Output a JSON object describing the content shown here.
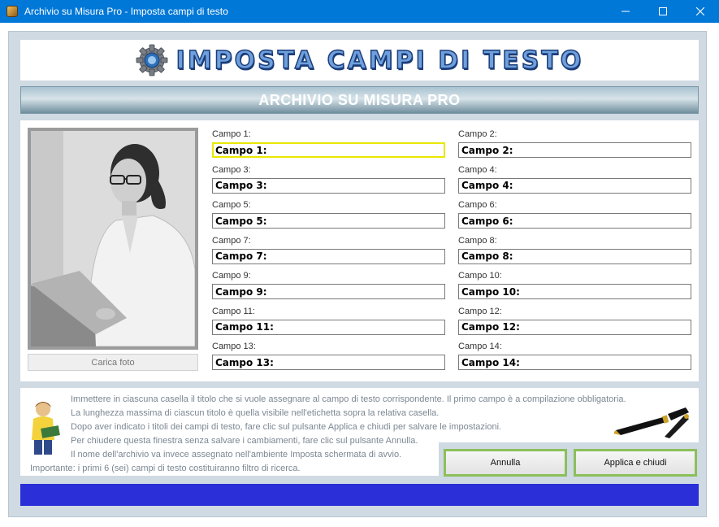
{
  "window": {
    "title": "Archivio su Misura Pro - Imposta campi di testo",
    "minimize_icon": "minimize-icon",
    "maximize_icon": "maximize-icon",
    "close_icon": "close-icon"
  },
  "header": {
    "title": "IMPOSTA CAMPI DI TESTO",
    "subtitle": "ARCHIVIO SU MISURA PRO",
    "logo_icon": "gear-icon"
  },
  "photo": {
    "button_label": "Carica foto"
  },
  "fields": [
    {
      "label": "Campo 1:",
      "value": "Campo 1:"
    },
    {
      "label": "Campo 2:",
      "value": "Campo 2:"
    },
    {
      "label": "Campo 3:",
      "value": "Campo 3:"
    },
    {
      "label": "Campo 4:",
      "value": "Campo 4:"
    },
    {
      "label": "Campo 5:",
      "value": "Campo 5:"
    },
    {
      "label": "Campo 6:",
      "value": "Campo 6:"
    },
    {
      "label": "Campo 7:",
      "value": "Campo 7:"
    },
    {
      "label": "Campo 8:",
      "value": "Campo 8:"
    },
    {
      "label": "Campo 9:",
      "value": "Campo 9:"
    },
    {
      "label": "Campo 10:",
      "value": "Campo 10:"
    },
    {
      "label": "Campo 11:",
      "value": "Campo 11:"
    },
    {
      "label": "Campo 12:",
      "value": "Campo 12:"
    },
    {
      "label": "Campo 13:",
      "value": "Campo 13:"
    },
    {
      "label": "Campo 14:",
      "value": "Campo 14:"
    }
  ],
  "info": [
    "Immettere in ciascuna casella il titolo che si vuole assegnare al campo di testo corrispondente. Il primo campo è a compilazione obbligatoria.",
    "La lunghezza massima di ciascun titolo è quella visibile nell'etichetta sopra la relativa casella.",
    "Dopo aver indicato i titoli dei campi di testo, fare clic sul pulsante Applica e chiudi per salvare le impostazioni.",
    "Per chiudere questa finestra senza salvare i cambiamenti, fare clic sul pulsante Annulla.",
    "Il nome dell'archivio va invece assegnato nell'ambiente Imposta schermata di avvio.",
    "Importante: i primi 6 (sei) campi di testo costituiranno filtro di ricerca."
  ],
  "buttons": {
    "cancel": "Annulla",
    "apply": "Applica e chiudi"
  },
  "colors": {
    "titlebar": "#0078d7",
    "accent_border": "#8cbf5a",
    "focus_border": "#e8e800",
    "status_bar": "#2b2fd8"
  }
}
